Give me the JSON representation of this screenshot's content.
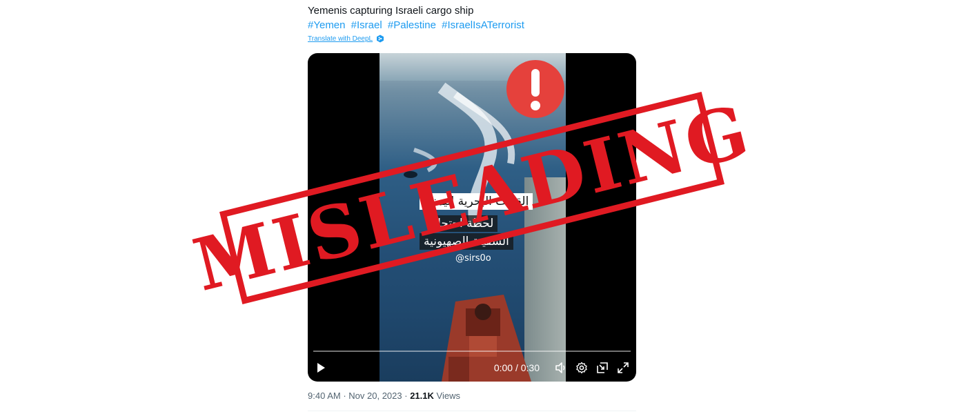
{
  "tweet": {
    "text": "Yemenis capturing Israeli cargo ship",
    "hashtags": [
      "#Yemen",
      "#Israel",
      "#Palestine",
      "#IsraelIsATerrorist"
    ],
    "translate_label": "Translate with DeepL"
  },
  "video": {
    "overlay_line1": "القوات البحرية اليمنية",
    "overlay_line2": "لحظة احتجاز",
    "overlay_line3": "السفينة الصهيونية",
    "watermark_handle": "@sirs0o",
    "time_display": "0:00 / 0:30",
    "progress": 0
  },
  "stamp": {
    "text": "MISLEADING",
    "color": "#e01a22"
  },
  "meta": {
    "time": "9:40 AM",
    "date": "Nov 20, 2023",
    "views_count": "21.1K",
    "views_label": "Views"
  },
  "colors": {
    "link": "#1d9bf0",
    "alert": "#e5413c",
    "stamp": "#e01a22"
  },
  "icons": [
    "deepl-icon",
    "alert-icon",
    "play-icon",
    "volume-icon",
    "settings-icon",
    "pip-icon",
    "fullscreen-icon"
  ]
}
